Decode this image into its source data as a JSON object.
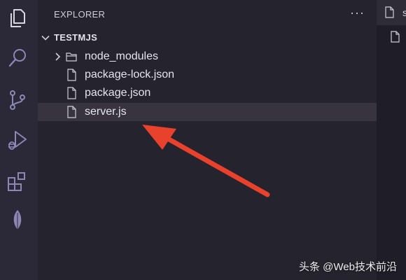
{
  "explorer": {
    "title": "EXPLORER",
    "more_actions": "···",
    "project": "TESTMJS",
    "items": [
      {
        "label": "node_modules",
        "type": "folder"
      },
      {
        "label": "package-lock.json",
        "type": "file"
      },
      {
        "label": "package.json",
        "type": "file"
      },
      {
        "label": "server.js",
        "type": "file",
        "selected": true
      }
    ]
  },
  "editor": {
    "tab_fragment": "s"
  },
  "activity_bar": {
    "icons": [
      "files-icon",
      "search-icon",
      "source-control-icon",
      "run-debug-icon",
      "extensions-icon",
      "mongodb-leaf-icon"
    ]
  },
  "watermark": "头条 @Web技术前沿",
  "colors": {
    "arrow": "#e8412c",
    "selection": "#37343f",
    "activity_bar": "#2b2937",
    "sidebar": "#25232e",
    "icon": "#8c87b5"
  }
}
